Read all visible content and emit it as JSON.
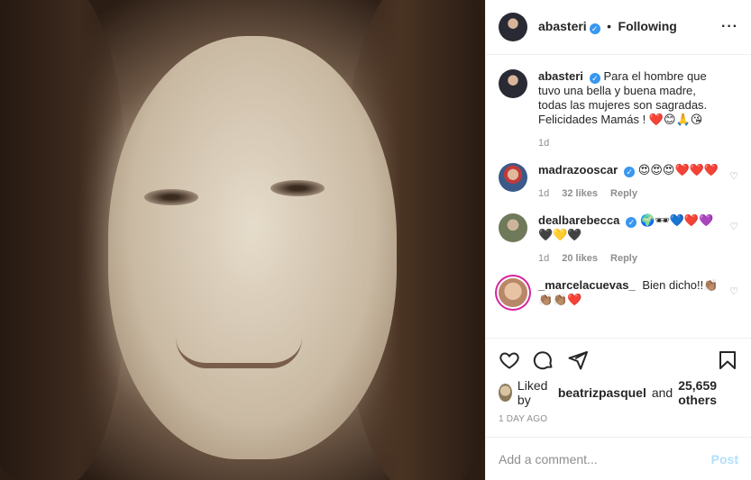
{
  "header": {
    "username": "abasteri",
    "separator": "•",
    "follow_state": "Following",
    "more": "···"
  },
  "caption": {
    "username": "abasteri",
    "text": "Para el hombre que tuvo una bella y buena madre, todas las mujeres son sagradas. Felicidades Mamás ! ❤️😊🙏😘",
    "time": "1d"
  },
  "comments": [
    {
      "username": "madrazooscar",
      "text": "😍😍😍❤️❤️❤️",
      "time": "1d",
      "likes": "32 likes",
      "reply": "Reply"
    },
    {
      "username": "dealbarebecca",
      "text": "🌍🕶💙❤️💜🖤💛🖤",
      "time": "1d",
      "likes": "20 likes",
      "reply": "Reply"
    },
    {
      "username": "_marcelacuevas_",
      "text": "Bien dicho!!👏🏽👏🏽👏🏽❤️",
      "time": "",
      "likes": "",
      "reply": ""
    }
  ],
  "likes": {
    "prefix": "Liked by",
    "user": "beatrizpasquel",
    "and": "and",
    "count": "25,659 others"
  },
  "time_ago": "1 DAY AGO",
  "add_comment": {
    "placeholder": "Add a comment...",
    "post_label": "Post"
  },
  "colors": {
    "accent": "#3897f0",
    "post_disabled": "#b2dffc",
    "muted": "#8e8e8e"
  }
}
